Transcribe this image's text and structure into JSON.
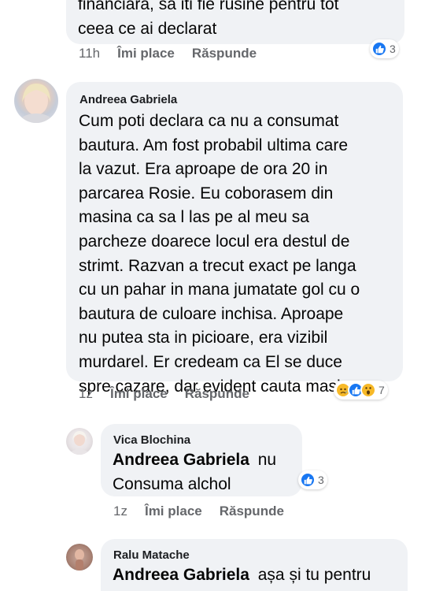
{
  "comments": [
    {
      "text_lines": [
        "financiara, sa iti fie rusine pentru tot",
        "ceea ce ai declarat"
      ],
      "time": "11h",
      "like_label": "Îmi place",
      "reply_label": "Răspunde",
      "reaction_count": "3"
    },
    {
      "author": "Andreea Gabriela",
      "text_lines": [
        "Cum poti declara ca nu a consumat",
        "bautura. Am fost probabil ultima care",
        "la vazut. Era aproape de ora 20 in",
        "parcarea Rosie. Eu coborasem din",
        "masina ca sa l las pe al meu sa",
        "parcheze doarece locul era destul de",
        "strimt. Razvan a trecut exact pe langa",
        "cu un pahar in mana jumatate gol cu o",
        "bautura de culoare inchisa. Aproape",
        "nu putea sta in picioare, era vizibil",
        "murdarel. Er credeam ca El se duce",
        "spre cazare, dar evident cauta masina"
      ],
      "time": "1z",
      "like_label": "Îmi place",
      "reply_label": "Răspunde",
      "reaction_count": "7"
    }
  ],
  "replies": [
    {
      "author": "Vica Blochina",
      "mention": "Andreea Gabriela",
      "text_first": "nu",
      "text_second": "Consuma alchol",
      "time": "1z",
      "like_label": "Îmi place",
      "reply_label": "Răspunde",
      "reaction_count": "3"
    },
    {
      "author": "Ralu Matache",
      "mention": "Andreea Gabriela",
      "text_first": "așa și tu pentru"
    }
  ],
  "colors": {
    "bubble": "#f0f2f5",
    "meta_text": "#65676b",
    "like_blue": "#1877f2",
    "emoji_yellow": "#f7b928"
  },
  "icons": [
    "like-icon",
    "sad-icon",
    "wow-icon"
  ]
}
